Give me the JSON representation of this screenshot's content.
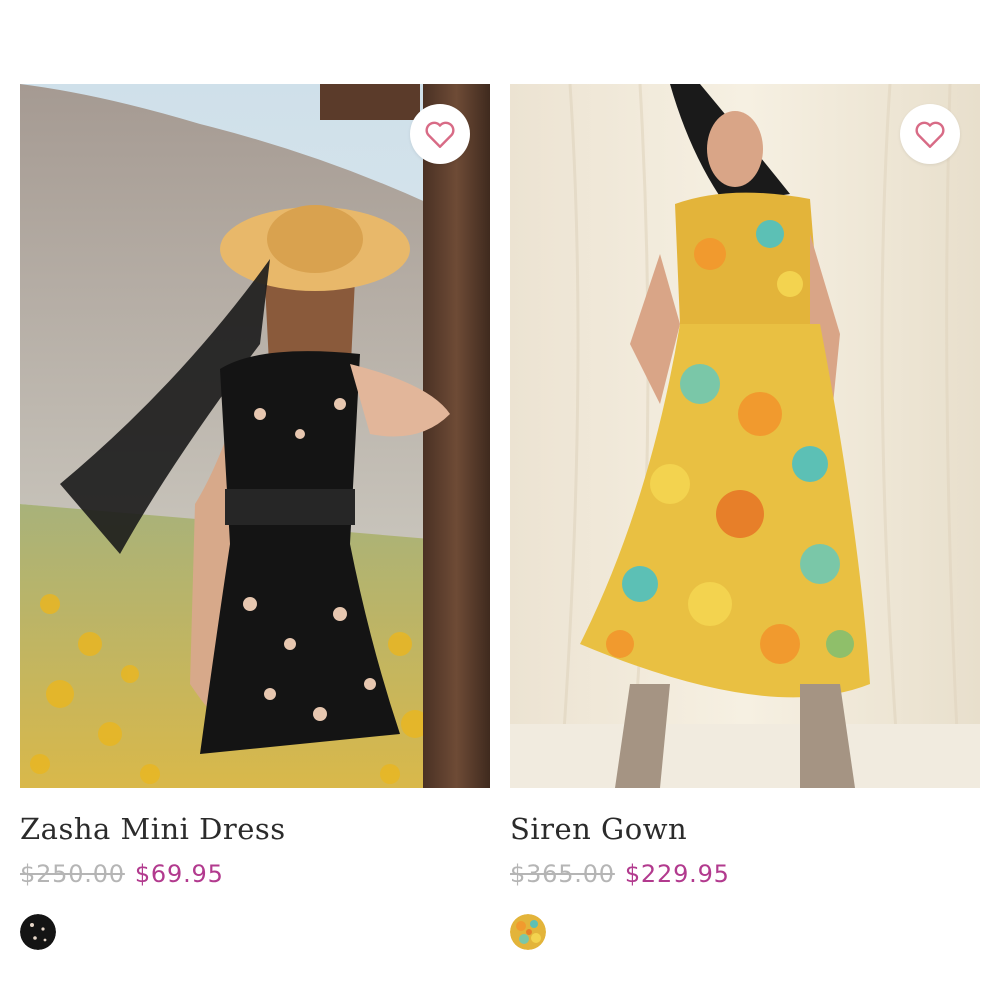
{
  "products": [
    {
      "name": "Zasha Mini Dress",
      "original_price": "$250.00",
      "sale_price": "$69.95",
      "swatch_color": "#141414"
    },
    {
      "name": "Siren Gown",
      "original_price": "$365.00",
      "sale_price": "$229.95",
      "swatch_color": "#e3b43a"
    }
  ],
  "colors": {
    "sale": "#b23a8e",
    "strike": "#b5b5b5",
    "heart": "#d86b86"
  },
  "icons": {
    "favorite": "heart-outline-icon"
  }
}
